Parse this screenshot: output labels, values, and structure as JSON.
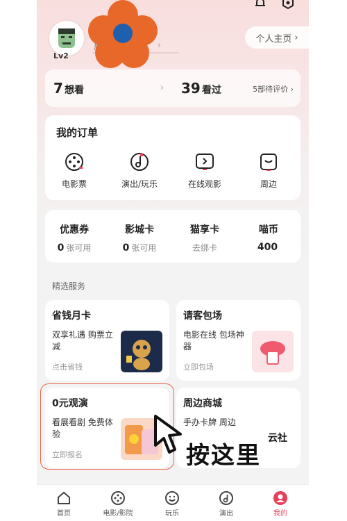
{
  "header": {
    "level": "Lv2",
    "profile_btn": "个人主页",
    "name_partial": "肩"
  },
  "stats": {
    "want_num": "7",
    "want_label": "想看",
    "seen_num": "39",
    "seen_label": "看过",
    "pending": "5部待评价"
  },
  "orders": {
    "title": "我的订单",
    "items": [
      {
        "label": "电影票",
        "icon": "film-reel-icon"
      },
      {
        "label": "演出/玩乐",
        "icon": "music-note-icon"
      },
      {
        "label": "在线观影",
        "icon": "play-screen-icon"
      },
      {
        "label": "周边",
        "icon": "bag-icon"
      }
    ]
  },
  "wallet": {
    "items": [
      {
        "title": "优惠券",
        "count": "0",
        "unit": "张可用"
      },
      {
        "title": "影城卡",
        "count": "0",
        "unit": "张可用"
      },
      {
        "title": "猫享卡",
        "count": "",
        "unit": "去绑卡"
      },
      {
        "title": "喵币",
        "count": "400",
        "unit": ""
      }
    ]
  },
  "services": {
    "section_title": "精选服务",
    "cards": [
      {
        "title": "省钱月卡",
        "desc": "双享礼遇 购票立减",
        "action": "点击省钱"
      },
      {
        "title": "请客包场",
        "desc": "电影在线 包场神器",
        "action": "立即包场"
      },
      {
        "title": "0元观演",
        "desc": "看展看剧 免费体验",
        "action": "立即报名"
      },
      {
        "title": "周边商城",
        "desc": "手办卡牌 周边",
        "action": ""
      }
    ]
  },
  "overlay": {
    "hint_text": "按这里",
    "stamp": "云社"
  },
  "tabbar": {
    "items": [
      {
        "label": "首页",
        "icon": "home-icon"
      },
      {
        "label": "电影/影院",
        "icon": "film-icon"
      },
      {
        "label": "玩乐",
        "icon": "smile-icon"
      },
      {
        "label": "演出",
        "icon": "music-icon"
      },
      {
        "label": "我的",
        "icon": "user-icon"
      }
    ]
  },
  "colors": {
    "accent": "#e8405a",
    "highlight": "#ea6547",
    "flower": "#e8682a",
    "flower_center": "#1e5fb0"
  }
}
